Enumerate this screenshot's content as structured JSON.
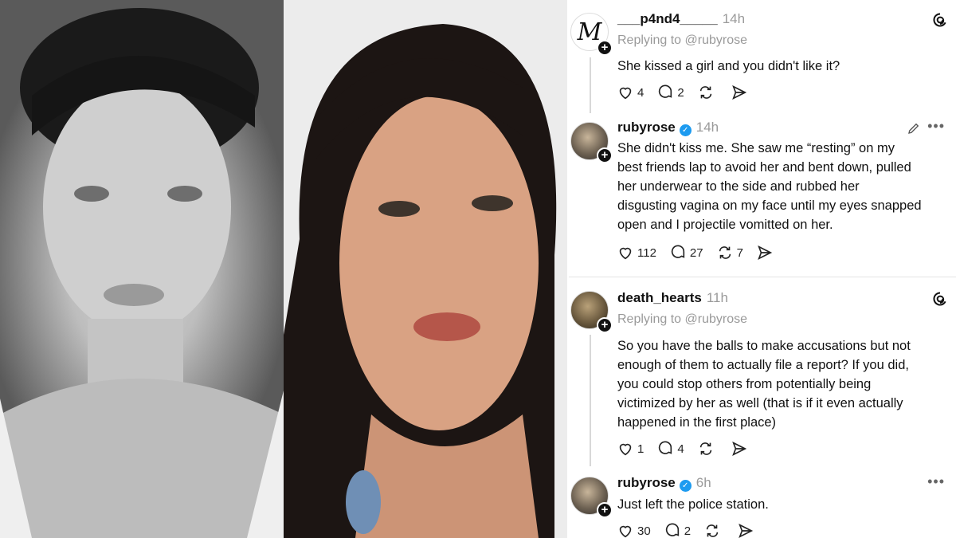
{
  "photos": {
    "left_alt_icon": "portrait-photo-bw",
    "right_alt_icon": "portrait-photo-color"
  },
  "thread": {
    "posts": [
      {
        "username": "___p4nd4_____",
        "time": "14h",
        "replying": "Replying to @rubyrose",
        "avatar_letter": "M",
        "text": "She kissed a girl and you didn't like it?",
        "likes": "4",
        "replies": "2",
        "reposts": "",
        "verified": false
      },
      {
        "username": "rubyrose",
        "time": "14h",
        "text_lines": [
          "She didn't kiss me. She saw me “resting” on my",
          "best friends lap to avoid her and bent down, pulled",
          "her underwear to the side and rubbed her",
          "disgusting vagina on my face until my eyes snapped",
          "open and I projectile vomitted on her."
        ],
        "likes": "112",
        "replies": "27",
        "reposts": "7",
        "verified": true
      },
      {
        "username": "death_hearts",
        "time": "11h",
        "replying": "Replying to @rubyrose",
        "text_lines": [
          "So you have the balls to make accusations but not",
          "enough of them to actually file a report? If you did,",
          "you could stop others from potentially being",
          "victimized by her as well (that is if it even actually",
          "happened in the first place)"
        ],
        "likes": "1",
        "replies": "4",
        "reposts": "",
        "verified": false
      },
      {
        "username": "rubyrose",
        "time": "6h",
        "text": "Just left the police station.",
        "likes": "30",
        "replies": "2",
        "reposts": "",
        "verified": true
      }
    ],
    "icons": {
      "like": "heart-icon",
      "reply": "comment-icon",
      "repost": "repost-icon",
      "share": "send-icon",
      "logo": "threads-logo-icon"
    },
    "colors": {
      "verified": "#1d9bf0",
      "muted": "#9a9a9a"
    }
  }
}
